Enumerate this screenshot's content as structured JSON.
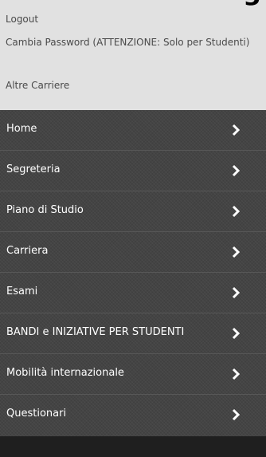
{
  "header": {
    "cut_title_fragment": "g"
  },
  "user_links": [
    "Logout",
    "Cambia Password (ATTENZIONE: Solo per Studenti)",
    "Altre Carriere"
  ],
  "menu": [
    {
      "label": "Home",
      "icon": "chevron-right-icon"
    },
    {
      "label": "Segreteria",
      "icon": "chevron-right-icon"
    },
    {
      "label": "Piano di Studio",
      "icon": "chevron-right-icon"
    },
    {
      "label": "Carriera",
      "icon": "chevron-right-icon"
    },
    {
      "label": "Esami",
      "icon": "chevron-right-icon"
    },
    {
      "label": "BANDI e INIZIATIVE PER STUDENTI",
      "icon": "chevron-right-icon"
    },
    {
      "label": "Mobilità internazionale",
      "icon": "chevron-right-icon"
    },
    {
      "label": "Questionari",
      "icon": "chevron-right-icon"
    }
  ],
  "colors": {
    "top_panel_bg": "#e1e1e1",
    "menu_bg": "#444444",
    "menu_text": "#ffffff",
    "link_text": "#4a4a4a"
  }
}
